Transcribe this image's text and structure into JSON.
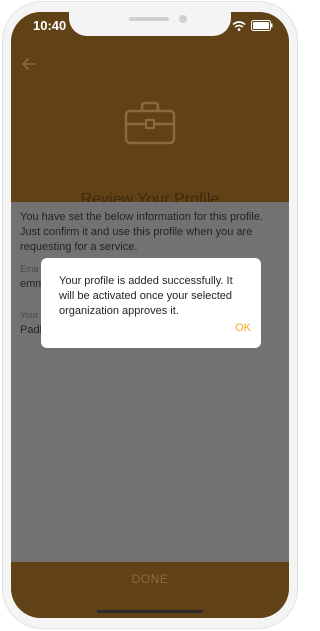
{
  "status_bar": {
    "time": "10:40"
  },
  "header": {
    "title": "Review Your Profile"
  },
  "content": {
    "intro": "You have set the below information for this profile. Just confirm it and use this profile when you are requesting for a service.",
    "fields": [
      {
        "label": "Ema",
        "value": "emm"
      },
      {
        "label": "Your",
        "value": "Padb"
      }
    ]
  },
  "footer": {
    "done_label": "DONE"
  },
  "dialog": {
    "message": "Your profile is added successfully. It will be activated once your selected organization approves it.",
    "ok_label": "OK"
  },
  "colors": {
    "header_bg": "#614216",
    "accent_ok": "#f0a828",
    "overlay": "#727272"
  }
}
